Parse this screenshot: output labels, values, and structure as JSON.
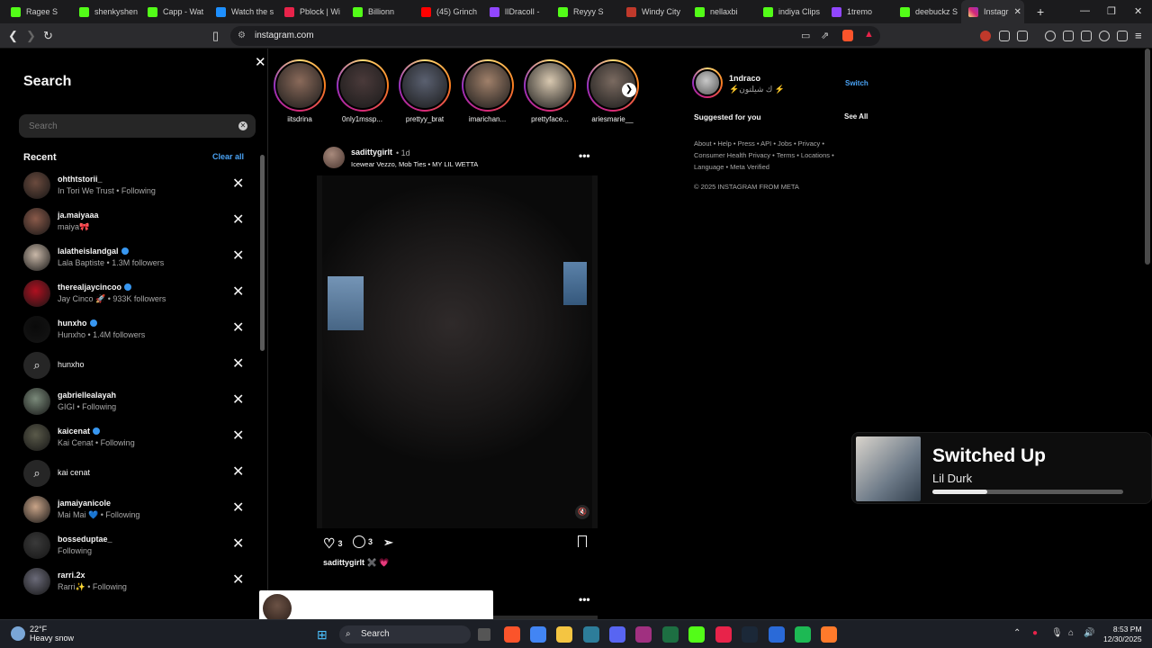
{
  "browser": {
    "tabs": [
      {
        "label": "Ragee S",
        "color": "#53fc18"
      },
      {
        "label": "shenkyshen",
        "color": "#53fc18"
      },
      {
        "label": "Capp - Wat",
        "color": "#53fc18"
      },
      {
        "label": "Watch the s",
        "color": "#1e90ff"
      },
      {
        "label": "Pblock | Wi",
        "color": "#e8234a"
      },
      {
        "label": "Billionn",
        "color": "#53fc18"
      },
      {
        "label": "(45) Grinch",
        "color": "#ff0000"
      },
      {
        "label": "lIDracolI -",
        "color": "#9146ff"
      },
      {
        "label": "Reyyy S",
        "color": "#53fc18"
      },
      {
        "label": "Windy City",
        "color": "#c0392b"
      },
      {
        "label": "nellaxbi",
        "color": "#53fc18"
      },
      {
        "label": "indiya Clips",
        "color": "#53fc18"
      },
      {
        "label": "1tremo",
        "color": "#9146ff"
      },
      {
        "label": "deebuckz S",
        "color": "#53fc18"
      }
    ],
    "active_tab": "Instagr",
    "url": "instagram.com"
  },
  "search_panel": {
    "title": "Search",
    "input_placeholder": "Search",
    "recent_label": "Recent",
    "clear_all": "Clear all",
    "items": [
      {
        "type": "user",
        "username": "ohthtstorii_",
        "verified": false,
        "sub": "In Tori We Trust • Following",
        "avatar": "#6b4b3e"
      },
      {
        "type": "user",
        "username": "ja.maiyaaa",
        "verified": false,
        "sub": "maiya🎀",
        "avatar": "#8a5a4a"
      },
      {
        "type": "user",
        "username": "lalatheislandgal",
        "verified": true,
        "sub": "Lala Baptiste • 1.3M followers",
        "avatar": "#c9b8a8"
      },
      {
        "type": "user",
        "username": "therealjaycincoo",
        "verified": true,
        "sub": "Jay Cinco 🚀 • 933K followers",
        "avatar": "#b01020"
      },
      {
        "type": "user",
        "username": "hunxho",
        "verified": true,
        "sub": "Hunxho • 1.4M followers",
        "avatar": "#0a0a0a"
      },
      {
        "type": "query",
        "text": "hunxho"
      },
      {
        "type": "user",
        "username": "gabriellealayah",
        "verified": false,
        "sub": "GIGI • Following",
        "avatar": "#7a8a7a"
      },
      {
        "type": "user",
        "username": "kaicenat",
        "verified": true,
        "sub": "Kai Cenat • Following",
        "avatar": "#5a5a4a"
      },
      {
        "type": "query",
        "text": "kai cenat"
      },
      {
        "type": "user",
        "username": "jamaiyanicole",
        "verified": false,
        "sub": "Mai Mai 💙 • Following",
        "avatar": "#c9a488"
      },
      {
        "type": "user",
        "username": "bosseduptae_",
        "verified": false,
        "sub": "Following",
        "avatar": "#3a3a3a"
      },
      {
        "type": "user",
        "username": "rarri.2x",
        "verified": false,
        "sub": "Rarri✨ • Following",
        "avatar": "#6a6a78"
      }
    ]
  },
  "stories": [
    {
      "name": "iitsdrina",
      "color": "#8a6a5a"
    },
    {
      "name": "0nly1mssp...",
      "color": "#4a3a3a"
    },
    {
      "name": "prettyy_brat",
      "color": "#5a6070"
    },
    {
      "name": "imarichan...",
      "color": "#a0806a"
    },
    {
      "name": "prettyface...",
      "color": "#d8c8b0"
    },
    {
      "name": "ariesmarie__",
      "color": "#7a6a60"
    }
  ],
  "post": {
    "username": "sadittygirlt",
    "time": "• 1d",
    "audio": "Icewear Vezzo, Mob Ties • MY LIL WETTA",
    "likes": "3",
    "comments": "3",
    "caption_user": "sadittygirlt",
    "caption_text": "✖️ 💗"
  },
  "sidebar_right": {
    "username": "1ndraco",
    "display_name": "⚡ك شيلتون ⚡",
    "switch": "Switch",
    "suggested": "Suggested for you",
    "see_all": "See All",
    "footer_links": "About • Help • Press • API • Jobs • Privacy • Consumer Health Privacy • Terms • Locations • Language • Meta Verified",
    "copyright": "© 2025 INSTAGRAM FROM META"
  },
  "media_overlay": {
    "title": "Switched Up",
    "artist": "Lil Durk",
    "progress": 0.29
  },
  "taskbar": {
    "weather_temp": "22°F",
    "weather_desc": "Heavy snow",
    "search": "Search",
    "time": "8:53 PM",
    "date": "12/30/2025",
    "apps": [
      {
        "name": "brave-icon",
        "color": "#fb542b"
      },
      {
        "name": "chrome-icon",
        "color": "#4285f4"
      },
      {
        "name": "file-explorer-icon",
        "color": "#f4c542"
      },
      {
        "name": "store-icon",
        "color": "#2d7d9a"
      },
      {
        "name": "discord-icon",
        "color": "#5865f2"
      },
      {
        "name": "winrar-icon",
        "color": "#a03080"
      },
      {
        "name": "excel-icon",
        "color": "#1d6f42"
      },
      {
        "name": "kick-icon",
        "color": "#53fc18"
      },
      {
        "name": "capcut-icon",
        "color": "#e8234a"
      },
      {
        "name": "steam-icon",
        "color": "#1b2838"
      },
      {
        "name": "4k-downloader-icon",
        "color": "#2a6ad8"
      },
      {
        "name": "spotify-icon",
        "color": "#1db954"
      },
      {
        "name": "app-icon",
        "color": "#ff7a2b"
      }
    ]
  }
}
